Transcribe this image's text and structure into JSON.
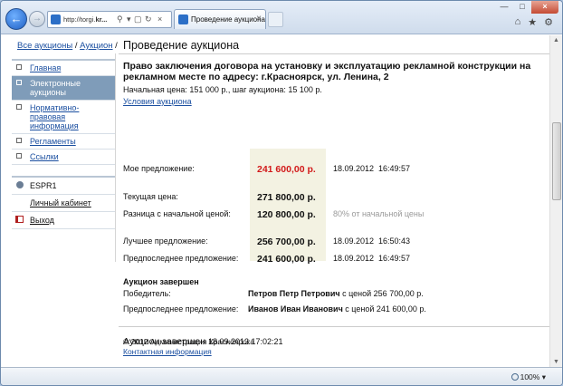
{
  "browser": {
    "url_prefix": "http://torgi.",
    "url_bold": "kr...",
    "tab_title": "Проведение аукциона",
    "tab_close": "×"
  },
  "breadcrumb": {
    "items": [
      "Все аукционы",
      "Аукцион"
    ],
    "separator": " / "
  },
  "page_title": "Проведение аукциона",
  "sidebar": {
    "items": [
      {
        "label": "Главная",
        "active": false
      },
      {
        "label": "Электронные аукционы",
        "active": true
      },
      {
        "label": "Нормативно-правовая информация",
        "active": false
      },
      {
        "label": "Регламенты",
        "active": false
      },
      {
        "label": "Ссылки",
        "active": false
      }
    ],
    "user_login": "ESPR1",
    "cabinet_label": "Личный кабинет",
    "exit_label": "Выход"
  },
  "lot": {
    "title": "Право заключения договора на установку и эксплуатацию рекламной конструкции на рекламном месте по адресу: г.Красноярск, ул. Ленина, 2",
    "meta": "Начальная цена: 151 000 р., шаг аукциона: 15 100 р.",
    "conditions_link": "Условия аукциона"
  },
  "bids": {
    "my_offer_label": "Мое предложение:",
    "my_offer_value": "241 600,00 р.",
    "my_offer_date": "18.09.2012",
    "my_offer_time": "16:49:57",
    "current_price_label": "Текущая цена:",
    "current_price_value": "271 800,00 р.",
    "diff_label": "Разница с начальной ценой:",
    "diff_value": "120 800,00 р.",
    "diff_percent": "80% от начальной цены",
    "best_label": "Лучшее предложение:",
    "best_value": "256 700,00 р.",
    "best_date": "18.09.2012",
    "best_time": "16:50:43",
    "prev_label": "Предпоследнее предложение:",
    "prev_value": "241 600,00 р.",
    "prev_date": "18.09.2012",
    "prev_time": "16:49:57"
  },
  "result": {
    "title": "Аукцион завершен",
    "winner_label": "Победитель:",
    "winner_name": "Петров Петр Петрович",
    "winner_rest": " с ценой 256 700,00 р.",
    "second_label": "Предпоследнее предложение:",
    "second_name": "Иванов Иван Иванович",
    "second_rest": " с ценой 241 600,00 р."
  },
  "final_status": {
    "label": "Аукцион завершен",
    "timestamp": "18.09.2012 17:02:21"
  },
  "footer": {
    "copyright": "© 2012 Администрация Красноярска",
    "contacts_link": "Контактная информация"
  },
  "statusbar": {
    "zoom": "100%",
    "zoom_arrow": "▾"
  }
}
